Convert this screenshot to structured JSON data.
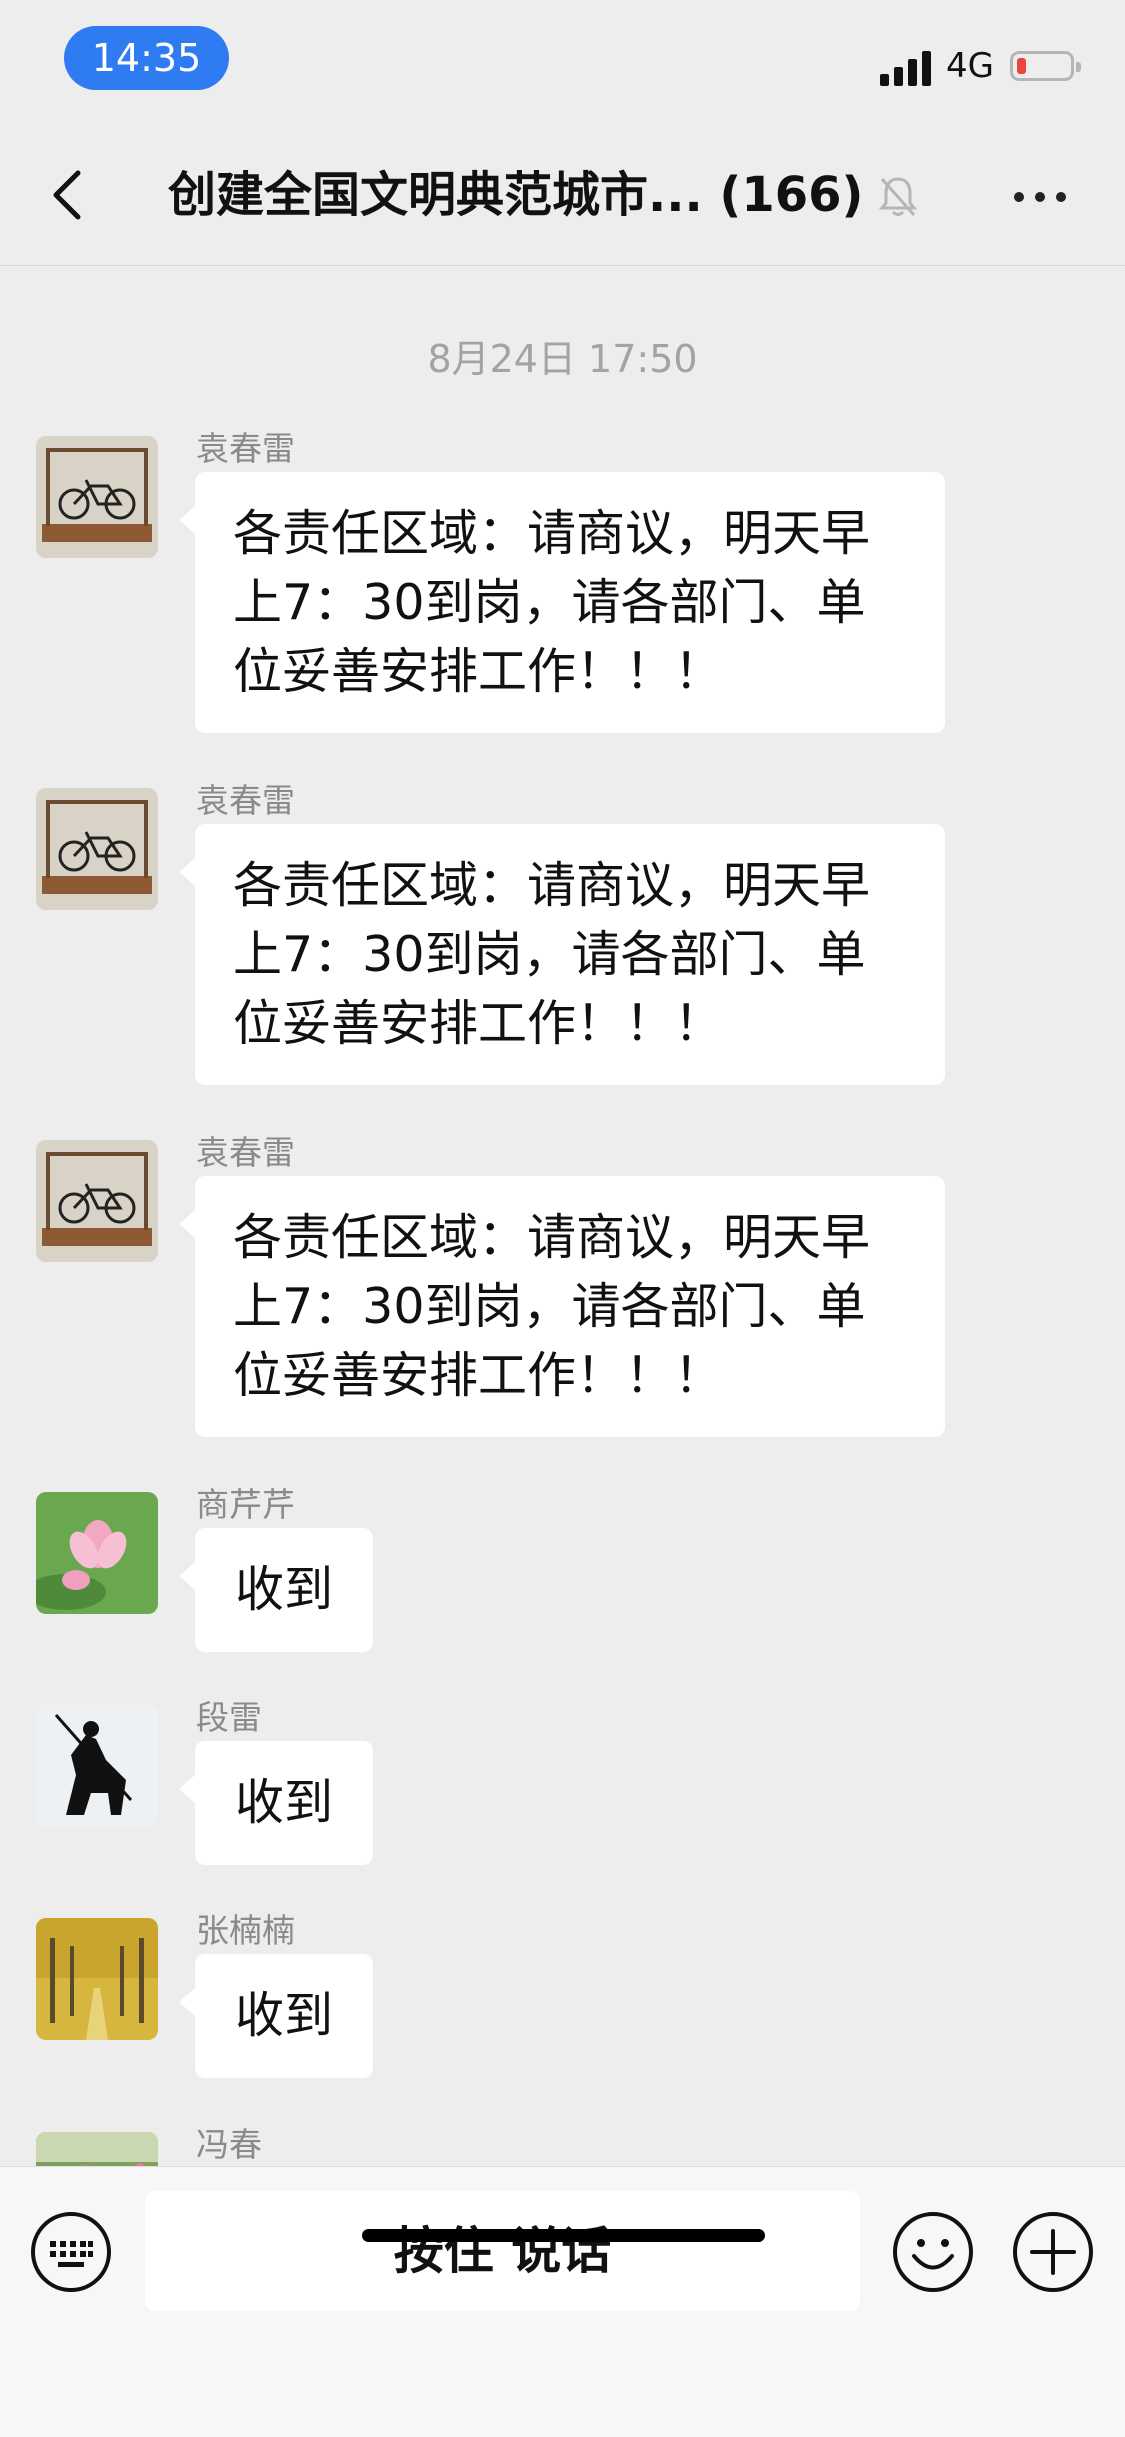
{
  "status_bar": {
    "time": "14:35",
    "network": "4G",
    "battery_level": 0.08,
    "battery_color": "#e8463e"
  },
  "nav": {
    "title": "创建全国文明典范城市... (166)",
    "muted": true
  },
  "chat": {
    "timestamp": "8月24日 17:50",
    "messages": [
      {
        "sender": "袁春雷",
        "avatar": "bicycle-avatar",
        "lines": [
          "各责任区域：请商议，明天早",
          "上7：30到岗，请各部门、单",
          "位妥善安排工作！！！"
        ]
      },
      {
        "sender": "袁春雷",
        "avatar": "bicycle-avatar",
        "lines": [
          "各责任区域：请商议，明天早",
          "上7：30到岗，请各部门、单",
          "位妥善安排工作！！！"
        ]
      },
      {
        "sender": "袁春雷",
        "avatar": "bicycle-avatar",
        "lines": [
          "各责任区域：请商议，明天早",
          "上7：30到岗，请各部门、单",
          "位妥善安排工作！！！"
        ]
      },
      {
        "sender": "商芹芹",
        "avatar": "lotus-avatar",
        "text": "收到"
      },
      {
        "sender": "段雷",
        "avatar": "rider-silhouette-avatar",
        "text": "收到"
      },
      {
        "sender": "张楠楠",
        "avatar": "ginkgo-path-avatar",
        "text": "收到"
      },
      {
        "sender": "冯春",
        "avatar": "flower-field-avatar",
        "text": ""
      }
    ]
  },
  "input_bar": {
    "hold_to_talk": "按住 说话"
  },
  "colors": {
    "accent": "#2f7bf1",
    "background": "#ededed",
    "bubble": "#ffffff"
  }
}
